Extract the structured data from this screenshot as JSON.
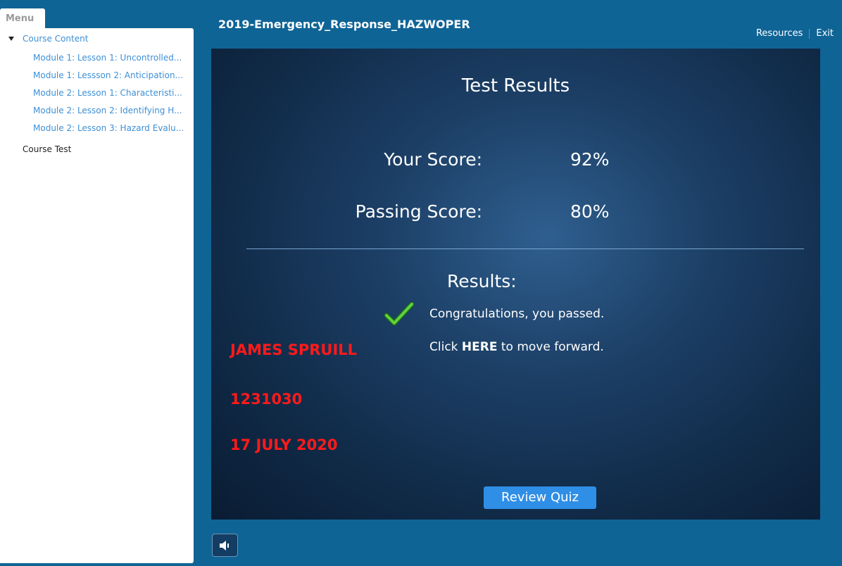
{
  "menu": {
    "tab_label": "Menu"
  },
  "sidebar": {
    "root_label": "Course Content",
    "lessons": [
      "Module 1: Lesson 1: Uncontrolled...",
      "Module 1: Lessson 2: Anticipation...",
      "Module 2: Lesson 1: Characteristi...",
      "Module 2: Lesson 2: Identifying H...",
      "Module 2: Lesson 3: Hazard Evalu..."
    ],
    "course_test_label": "Course Test"
  },
  "header": {
    "title": "2019-Emergency_Response_HAZWOPER",
    "resources_label": "Resources",
    "exit_label": "Exit"
  },
  "results": {
    "title": "Test Results",
    "your_score_label": "Your Score:",
    "your_score_value": "92%",
    "passing_score_label": "Passing Score:",
    "passing_score_value": "80%",
    "results_label": "Results:",
    "passed_message": "Congratulations, you passed.",
    "click_prefix": "Click",
    "click_here": "HERE",
    "click_suffix": "to move forward.",
    "review_button": "Review Quiz"
  },
  "stamp": {
    "name": "JAMES SPRUILL",
    "id": "1231030",
    "date": "17 JULY 2020"
  },
  "colors": {
    "background": "#0f6496",
    "link": "#3d8fd6",
    "stamp": "#ff1a1a",
    "button": "#2f8ee6",
    "check": "#3fbf2e"
  },
  "icons": {
    "menu_expand": "triangle-down-icon",
    "passed": "checkmark-icon",
    "audio": "speaker-icon"
  }
}
